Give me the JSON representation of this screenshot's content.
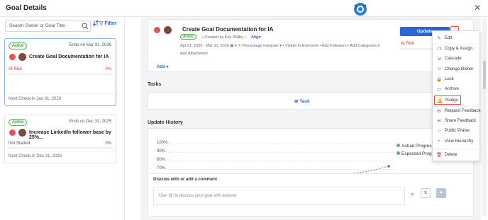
{
  "header": {
    "title": "Goal Details",
    "close": "✕"
  },
  "sidebar": {
    "search_placeholder": "Search Owner or Goal Title",
    "filter_label": "Filter",
    "cards": [
      {
        "status": "Active",
        "ends": "Ends on Mar 31, 2026",
        "title": "Create Goal Documentation for IA",
        "progress_status": "At Risk",
        "progress": "0%",
        "next_checkin": "Next Check-in Jan 01, 2026"
      },
      {
        "status": "Active",
        "ends": "Ends on Dec 31, 2025",
        "title": "Increase LinkedIn follower base by 25%...",
        "progress_status": "Not Started",
        "progress": "0%",
        "next_checkin": "Next Check-in Dec 31, 2025"
      }
    ]
  },
  "goal": {
    "title": "Create Goal Documentation for IA",
    "status": "Active",
    "created_by": "• Created by Kay Walby •",
    "align": "Align",
    "meta": "Apr 01, 2025 - Mar 31, 2026   ▦   ▾   ✕ Percentage   Integrate   ▾   • Visible to Everyone   • Add Followers   • Add Categories   ▾",
    "add_attachment": "Add Attachment",
    "add": "Add",
    "update": "Update",
    "kebab": "⋮",
    "risk": "At Risk"
  },
  "tasks": {
    "section": "Tasks",
    "add_task": "Task"
  },
  "history": {
    "section": "Update History",
    "yticks": [
      "100%",
      "90%",
      "80%",
      "70%"
    ],
    "legend": [
      "Actual Progress",
      "Expected Progre"
    ],
    "comment_title": "Discuss with or add a comment",
    "comment_placeholder": "Use '@' to discuss your goal with anyone"
  },
  "menu": {
    "items": [
      {
        "label": "Edit",
        "icon": "✎"
      },
      {
        "label": "Copy & Assign",
        "icon": "❐"
      },
      {
        "label": "Cascade",
        "icon": "⇲"
      },
      {
        "label": "Change Owner",
        "icon": "☺"
      },
      {
        "label": "Lock",
        "icon": "🔒"
      },
      {
        "label": "Archive",
        "icon": "▭"
      },
      {
        "label": "Nudge",
        "icon": "🔔"
      },
      {
        "label": "Request Feedback",
        "icon": "✉"
      },
      {
        "label": "Share Feedback",
        "icon": "✉"
      },
      {
        "label": "Public Praise",
        "icon": "☆"
      },
      {
        "label": "View Hierarchy",
        "icon": "⑂"
      },
      {
        "label": "Delete",
        "icon": "🗑"
      }
    ]
  },
  "colors": {
    "accent": "#2a66d9",
    "risk": "#e55353",
    "active": "#2f8a2f",
    "highlight": "#e04e39"
  }
}
